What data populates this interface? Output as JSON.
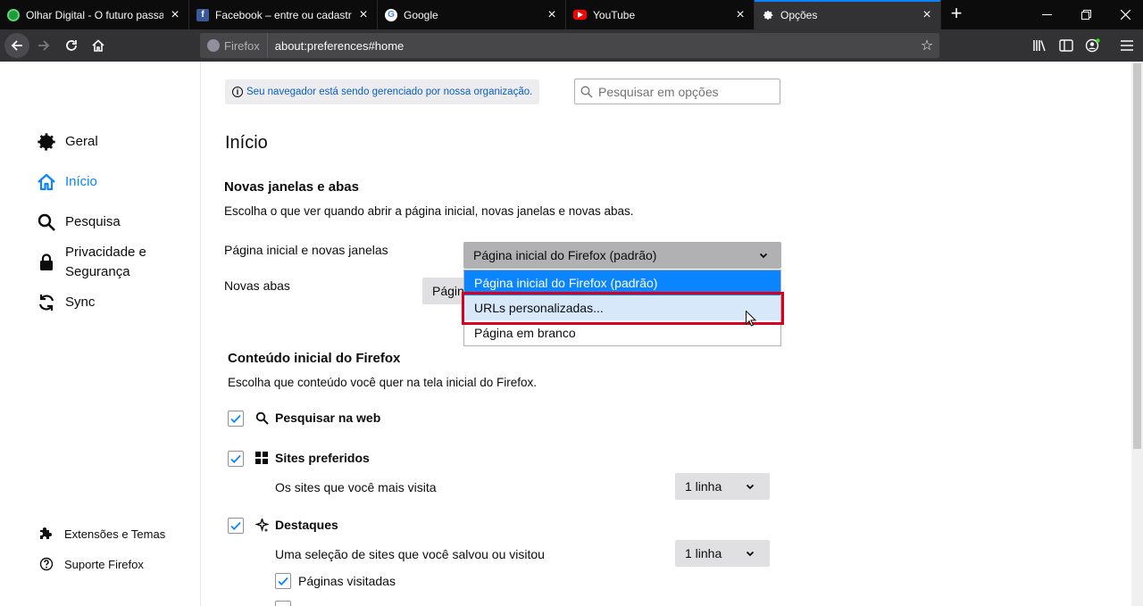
{
  "tabs": [
    {
      "title": "Olhar Digital - O futuro passa p",
      "icon": "olhar-digital-favicon",
      "active": false
    },
    {
      "title": "Facebook – entre ou cadastre-se",
      "icon": "facebook-favicon",
      "active": false
    },
    {
      "title": "Google",
      "icon": "google-favicon",
      "active": false
    },
    {
      "title": "YouTube",
      "icon": "youtube-favicon",
      "active": false
    },
    {
      "title": "Opções",
      "icon": "gear-icon",
      "active": true
    }
  ],
  "navbar": {
    "identity_label": "Firefox",
    "url": "about:preferences#home"
  },
  "sidebar": {
    "categories": [
      {
        "label": "Geral",
        "icon": "gear-icon"
      },
      {
        "label": "Início",
        "icon": "home-icon"
      },
      {
        "label": "Pesquisa",
        "icon": "search-icon"
      },
      {
        "label": "Privacidade e",
        "label2": "Segurança",
        "icon": "lock-icon"
      },
      {
        "label": "Sync",
        "icon": "sync-icon"
      }
    ],
    "footer": [
      {
        "label": "Extensões e Temas",
        "icon": "puzzle-icon"
      },
      {
        "label": "Suporte Firefox",
        "icon": "help-icon"
      }
    ]
  },
  "managed_notice": "Seu navegador está sendo gerenciado por nossa organização.",
  "search_placeholder": "Pesquisar em opções",
  "page_title": "Início",
  "new_windows": {
    "heading": "Novas janelas e abas",
    "description": "Escolha o que ver quando abrir a página inicial, novas janelas e novas abas.",
    "homepage_label": "Página inicial e novas janelas",
    "homepage_value": "Página inicial do Firefox (padrão)",
    "newtab_label": "Novas abas",
    "newtab_value": "Págin",
    "dropdown_options": [
      "Página inicial do Firefox (padrão)",
      "URLs personalizadas...",
      "Página em branco"
    ]
  },
  "home_content": {
    "heading": "Conteúdo inicial do Firefox",
    "description": "Escolha que conteúdo você quer na tela inicial do Firefox.",
    "items": [
      {
        "label": "Pesquisar na web",
        "checked": true,
        "icon": "search-icon"
      },
      {
        "label": "Sites preferidos",
        "checked": true,
        "icon": "grid-icon",
        "sub": "Os sites que você mais visita",
        "rows": "1 linha"
      },
      {
        "label": "Destaques",
        "checked": true,
        "icon": "sparkle-icon",
        "sub": "Uma seleção de sites que você salvou ou visitou",
        "rows": "1 linha"
      }
    ],
    "sub_checkbox": {
      "label": "Páginas visitadas",
      "checked": true
    }
  },
  "colors": {
    "accent": "#0a84ff",
    "highlight_box": "#d70022",
    "tab_strip": "#0c0c0d",
    "nav_bar": "#323234"
  }
}
